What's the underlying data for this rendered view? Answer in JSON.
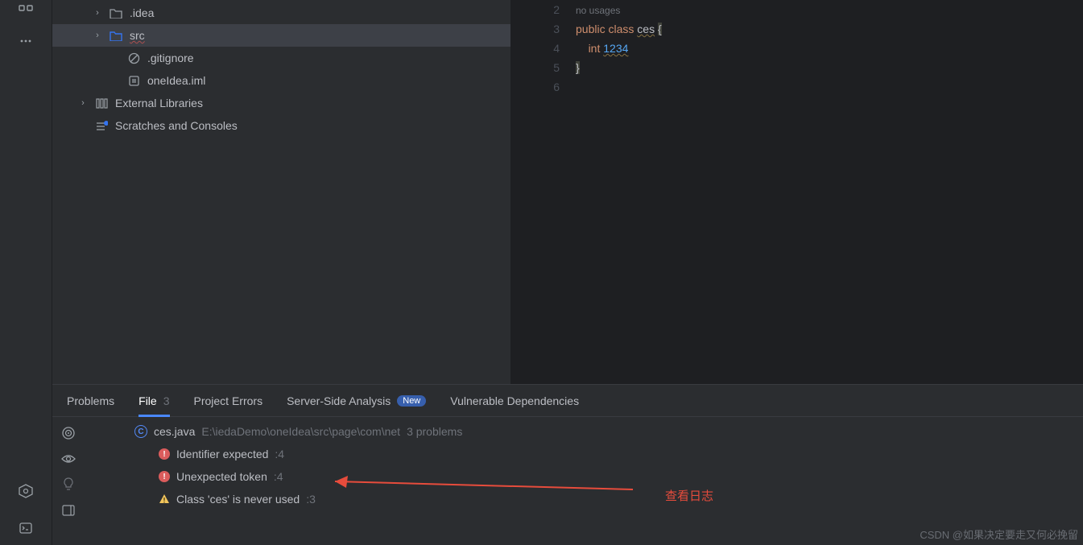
{
  "project_tree": {
    "idea": ".idea",
    "src": "src",
    "gitignore": ".gitignore",
    "iml": "oneIdea.iml",
    "ext_lib": "External Libraries",
    "scratches": "Scratches and Consoles"
  },
  "editor": {
    "gutter": [
      "2",
      "3",
      "4",
      "5",
      "6"
    ],
    "hint": "no usages",
    "line3_kw1": "public",
    "line3_kw2": "class",
    "line3_cls": "ces",
    "line3_brace": "{",
    "line4_kw": "int",
    "line4_num": "1234",
    "line5_brace": "}"
  },
  "panel": {
    "tabs": {
      "problems": "Problems",
      "file": "File",
      "file_count": "3",
      "project_errors": "Project Errors",
      "ssa": "Server-Side Analysis",
      "ssa_badge": "New",
      "vuln": "Vulnerable Dependencies"
    },
    "file_header": {
      "name": "ces.java",
      "path": "E:\\iedaDemo\\oneIdea\\src\\page\\com\\net",
      "summary": "3 problems"
    },
    "problems": [
      {
        "icon": "error",
        "msg": "Identifier expected",
        "loc": ":4"
      },
      {
        "icon": "error",
        "msg": "Unexpected token",
        "loc": ":4"
      },
      {
        "icon": "warn",
        "msg": "Class 'ces' is never used",
        "loc": ":3"
      }
    ]
  },
  "annotation": "查看日志",
  "watermark": "CSDN @如果决定要走又何必挽留"
}
